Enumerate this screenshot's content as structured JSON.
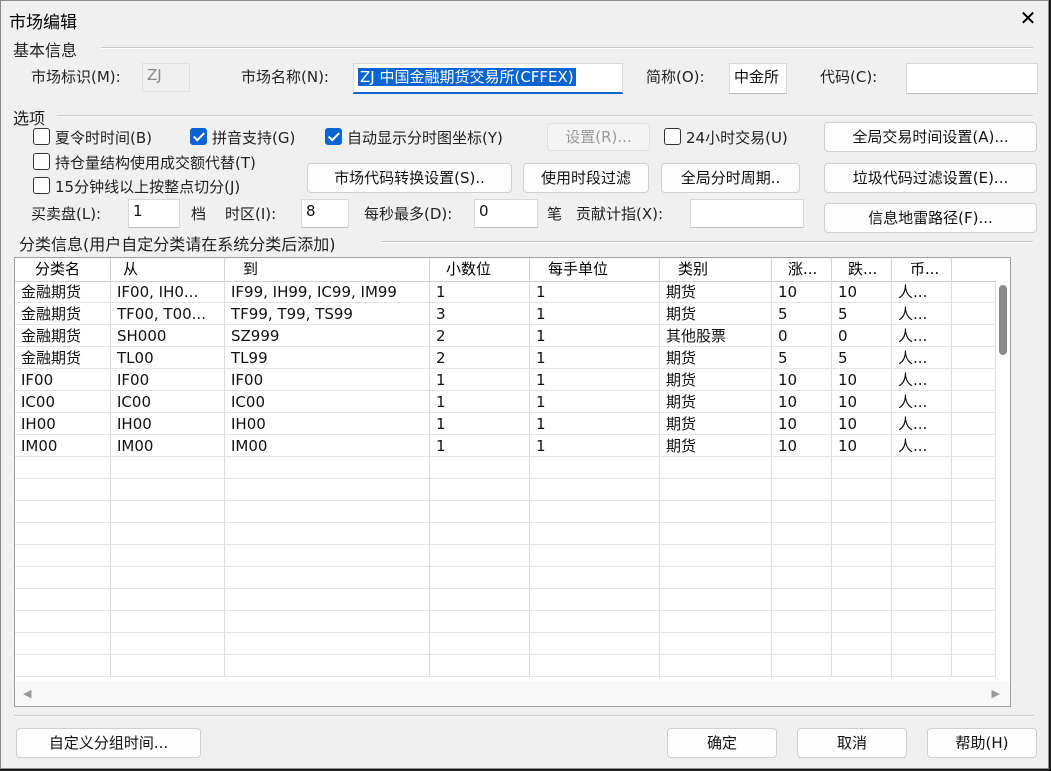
{
  "window": {
    "title": "市场编辑"
  },
  "basic": {
    "group": "基本信息",
    "market_id_label": "市场标识(M):",
    "market_id_value": "ZJ",
    "market_name_label": "市场名称(N):",
    "market_name_value": "ZJ 中国金融期货交易所(CFFEX)",
    "short_label": "简称(O):",
    "short_value": "中金所",
    "code_label": "代码(C):",
    "code_value": ""
  },
  "options": {
    "group": "选项",
    "dst": {
      "label": "夏令时时间(B)",
      "checked": false
    },
    "pinyin": {
      "label": "拼音支持(G)",
      "checked": true
    },
    "auto_axis": {
      "label": "自动显示分时图坐标(Y)",
      "checked": true
    },
    "settings_button": "设置(R)...",
    "h24": {
      "label": "24小时交易(U)",
      "checked": false
    },
    "global_time_button": "全局交易时间设置(A)...",
    "position": {
      "label": "持仓量结构使用成交额代替(T)",
      "checked": false
    },
    "min15": {
      "label": "15分钟线以上按整点切分(J)",
      "checked": false
    },
    "code_convert_button": "市场代码转换设置(S)..",
    "period_filter_button": "使用时段过滤",
    "global_period_button": "全局分时周期..",
    "junk_filter_button": "垃圾代码过滤设置(E)...",
    "bidask_label": "买卖盘(L):",
    "bidask_value": "1",
    "bidask_unit": "档",
    "tz_label": "时区(I):",
    "tz_value": "8",
    "persec_label": "每秒最多(D):",
    "persec_value": "0",
    "persec_unit": "笔",
    "contrib_label": "贡献计指(X):",
    "contrib_value": "",
    "mine_path_button": "信息地雷路径(F)..."
  },
  "category": {
    "group": "分类信息(用户自定分类请在系统分类后添加)",
    "columns": [
      "分类名",
      "从",
      "到",
      "小数位",
      "每手单位",
      "类别",
      "涨...",
      "跌...",
      "币..."
    ],
    "rows": [
      [
        "金融期货",
        "IF00, IH0...",
        "IF99, IH99, IC99, IM99",
        "1",
        "1",
        "期货",
        "10",
        "10",
        "人..."
      ],
      [
        "金融期货",
        "TF00, T00...",
        "TF99, T99, TS99",
        "3",
        "1",
        "期货",
        "5",
        "5",
        "人..."
      ],
      [
        "金融期货",
        "SH000",
        "SZ999",
        "2",
        "1",
        "其他股票",
        "0",
        "0",
        "人..."
      ],
      [
        "金融期货",
        "TL00",
        "TL99",
        "2",
        "1",
        "期货",
        "5",
        "5",
        "人..."
      ],
      [
        "IF00",
        "IF00",
        "IF00",
        "1",
        "1",
        "期货",
        "10",
        "10",
        "人..."
      ],
      [
        "IC00",
        "IC00",
        "IC00",
        "1",
        "1",
        "期货",
        "10",
        "10",
        "人..."
      ],
      [
        "IH00",
        "IH00",
        "IH00",
        "1",
        "1",
        "期货",
        "10",
        "10",
        "人..."
      ],
      [
        "IM00",
        "IM00",
        "IM00",
        "1",
        "1",
        "期货",
        "10",
        "10",
        "人..."
      ]
    ]
  },
  "footer": {
    "custom_group_button": "自定义分组时间...",
    "ok_button": "确定",
    "cancel_button": "取消",
    "help_button": "帮助(H)"
  },
  "icons": {
    "close": "close-icon",
    "check": "checkmark-icon"
  }
}
